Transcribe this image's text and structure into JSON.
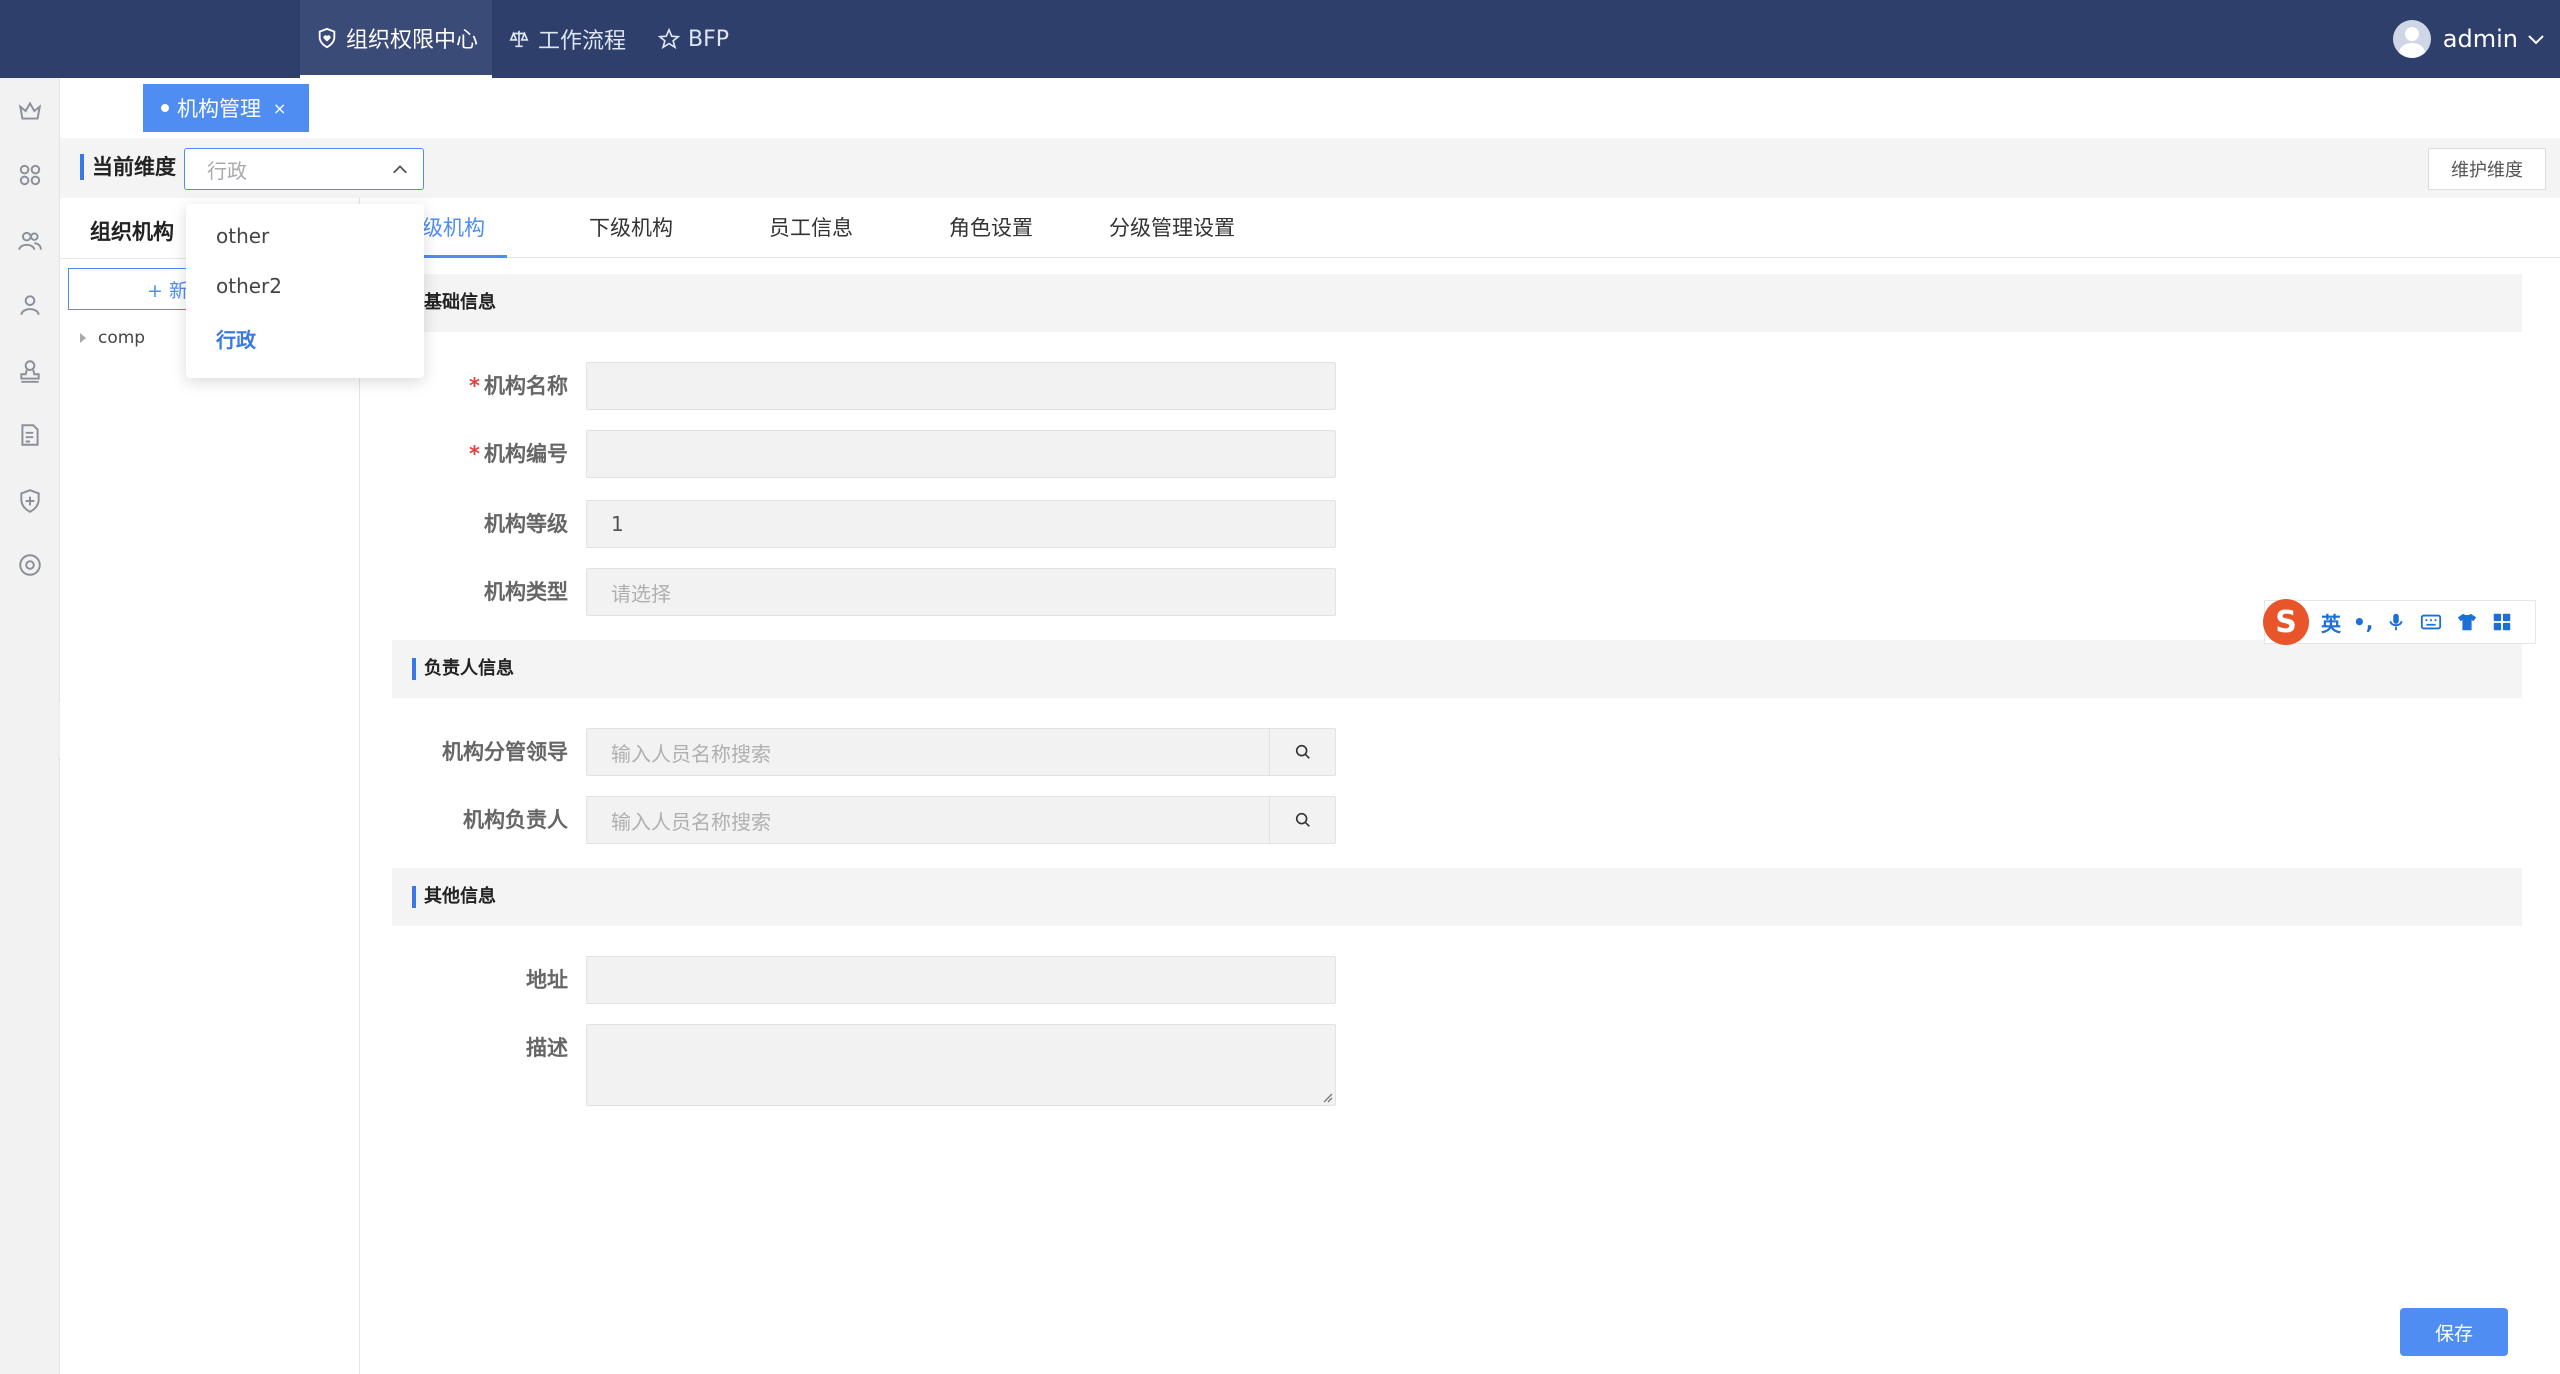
{
  "topnav": {
    "items": [
      {
        "label": "组织权限中心",
        "icon": "shield-heart-icon"
      },
      {
        "label": "工作流程",
        "icon": "balance-icon"
      },
      {
        "label": "BFP",
        "icon": "star-icon"
      }
    ],
    "user": "admin"
  },
  "rail": {
    "icons": [
      "crown-icon",
      "apps-icon",
      "team-icon",
      "user-icon",
      "stamp-icon",
      "document-icon",
      "shield-plus-icon",
      "settings-icon"
    ]
  },
  "tagbar": {
    "tag_label": "机构管理",
    "close": "×"
  },
  "dimension": {
    "label": "当前维度",
    "select_value": "行政",
    "maintain_button": "维护维度",
    "options": [
      "other",
      "other2",
      "行政"
    ],
    "selected": "行政"
  },
  "tree": {
    "header": "组织机构",
    "add_button": "+ 新",
    "root_node": "comp"
  },
  "tabs": [
    "本级机构",
    "下级机构",
    "员工信息",
    "角色设置",
    "分级管理设置"
  ],
  "form": {
    "basic_title": "基础信息",
    "name_label": "机构名称",
    "code_label": "机构编号",
    "level_label": "机构等级",
    "level_value": "1",
    "type_label": "机构类型",
    "type_placeholder": "请选择",
    "owner_title": "负责人信息",
    "leader_label": "机构分管领导",
    "leader_placeholder": "输入人员名称搜索",
    "head_label": "机构负责人",
    "head_placeholder": "输入人员名称搜索",
    "other_title": "其他信息",
    "address_label": "地址",
    "desc_label": "描述",
    "required_mark": "*"
  },
  "save_button": "保存",
  "ime": {
    "logo": "S",
    "lang": "英",
    "punct": "•,"
  },
  "colors": {
    "nav_bg": "#2e3f6b",
    "accent": "#4f8df2",
    "required": "#e0413d"
  }
}
